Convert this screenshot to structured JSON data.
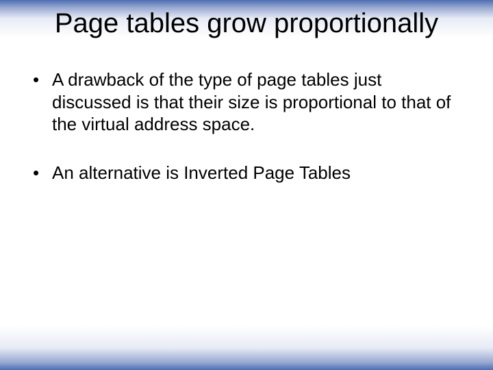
{
  "slide": {
    "title": "Page tables grow proportionally",
    "bullets": [
      "A drawback of the type of page tables just discussed is that their size is proportional to that of the virtual address space.",
      "An alternative is Inverted Page Tables"
    ]
  }
}
